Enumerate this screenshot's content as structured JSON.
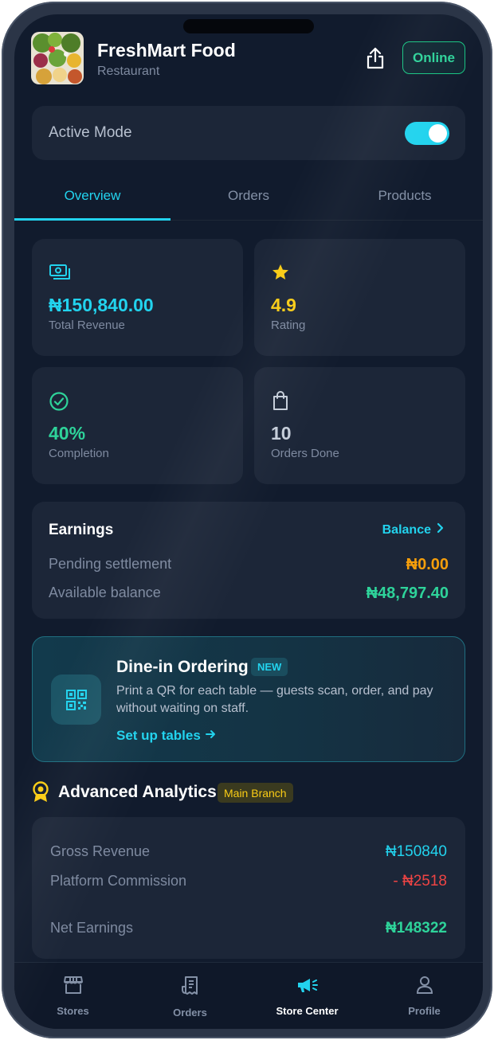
{
  "header": {
    "store_name": "FreshMart Food",
    "store_type": "Restaurant",
    "status_button": "Online"
  },
  "active_mode": {
    "label": "Active Mode",
    "enabled": true
  },
  "tabs": [
    {
      "label": "Overview",
      "active": true
    },
    {
      "label": "Orders",
      "active": false
    },
    {
      "label": "Products",
      "active": false
    }
  ],
  "stats": [
    {
      "icon": "money-icon",
      "value": "₦150,840.00",
      "label": "Total Revenue",
      "color": "#22d3ee"
    },
    {
      "icon": "star-icon",
      "value": "4.9",
      "label": "Rating",
      "color": "#facc15"
    },
    {
      "icon": "check-circle-icon",
      "value": "40%",
      "label": "Completion",
      "color": "#2ed39a"
    },
    {
      "icon": "shopping-bag-icon",
      "value": "10",
      "label": "Orders Done",
      "color": "#c5cdd9"
    }
  ],
  "earnings": {
    "title": "Earnings",
    "link": "Balance",
    "pending_label": "Pending settlement",
    "pending_value": "₦0.00",
    "available_label": "Available balance",
    "available_value": "₦48,797.40"
  },
  "dine_in": {
    "title": "Dine-in Ordering",
    "badge": "NEW",
    "description": "Print a QR for each table — guests scan, order, and pay without waiting on staff.",
    "link": "Set up tables"
  },
  "analytics": {
    "title": "Advanced Analytics",
    "badge": "Main Branch",
    "gross_label": "Gross Revenue",
    "gross_value": "₦150840",
    "commission_label": "Platform Commission",
    "commission_value": "- ₦2518",
    "net_label": "Net Earnings",
    "net_value": "₦148322"
  },
  "nav": [
    {
      "label": "Stores",
      "icon": "store-icon",
      "active": false
    },
    {
      "label": "Orders",
      "icon": "receipt-icon",
      "active": false
    },
    {
      "label": "Store Center",
      "icon": "megaphone-icon",
      "active": true
    },
    {
      "label": "Profile",
      "icon": "user-icon",
      "active": false
    }
  ],
  "colors": {
    "accent": "#22d3ee",
    "success": "#2ed39a",
    "warning": "#f59e0b",
    "danger": "#ef4444",
    "gold": "#facc15",
    "background": "#111b2d",
    "card": "#1c2638"
  }
}
